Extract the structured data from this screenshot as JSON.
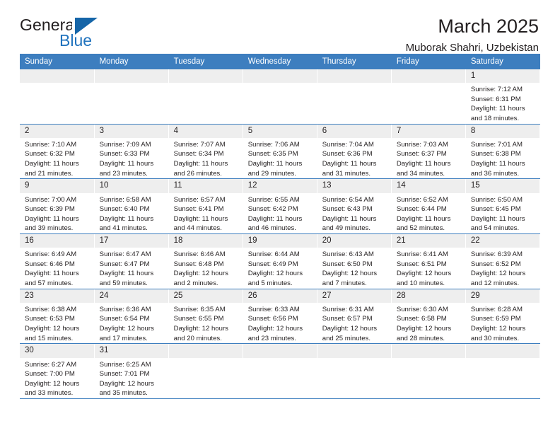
{
  "brand": {
    "name_top": "General",
    "name_bottom": "Blue",
    "accent_color": "#1f72bd",
    "triangle_color": "#1565a8"
  },
  "header": {
    "title": "March 2025",
    "subtitle": "Muborak Shahri, Uzbekistan",
    "header_bg": "#3d7ebf",
    "header_text_color": "#ffffff",
    "daynum_bg": "#eeeeee"
  },
  "weekdays": [
    "Sunday",
    "Monday",
    "Tuesday",
    "Wednesday",
    "Thursday",
    "Friday",
    "Saturday"
  ],
  "weeks": [
    [
      {
        "day": "",
        "lines": []
      },
      {
        "day": "",
        "lines": []
      },
      {
        "day": "",
        "lines": []
      },
      {
        "day": "",
        "lines": []
      },
      {
        "day": "",
        "lines": []
      },
      {
        "day": "",
        "lines": []
      },
      {
        "day": "1",
        "lines": [
          "Sunrise: 7:12 AM",
          "Sunset: 6:31 PM",
          "Daylight: 11 hours",
          "and 18 minutes."
        ]
      }
    ],
    [
      {
        "day": "2",
        "lines": [
          "Sunrise: 7:10 AM",
          "Sunset: 6:32 PM",
          "Daylight: 11 hours",
          "and 21 minutes."
        ]
      },
      {
        "day": "3",
        "lines": [
          "Sunrise: 7:09 AM",
          "Sunset: 6:33 PM",
          "Daylight: 11 hours",
          "and 23 minutes."
        ]
      },
      {
        "day": "4",
        "lines": [
          "Sunrise: 7:07 AM",
          "Sunset: 6:34 PM",
          "Daylight: 11 hours",
          "and 26 minutes."
        ]
      },
      {
        "day": "5",
        "lines": [
          "Sunrise: 7:06 AM",
          "Sunset: 6:35 PM",
          "Daylight: 11 hours",
          "and 29 minutes."
        ]
      },
      {
        "day": "6",
        "lines": [
          "Sunrise: 7:04 AM",
          "Sunset: 6:36 PM",
          "Daylight: 11 hours",
          "and 31 minutes."
        ]
      },
      {
        "day": "7",
        "lines": [
          "Sunrise: 7:03 AM",
          "Sunset: 6:37 PM",
          "Daylight: 11 hours",
          "and 34 minutes."
        ]
      },
      {
        "day": "8",
        "lines": [
          "Sunrise: 7:01 AM",
          "Sunset: 6:38 PM",
          "Daylight: 11 hours",
          "and 36 minutes."
        ]
      }
    ],
    [
      {
        "day": "9",
        "lines": [
          "Sunrise: 7:00 AM",
          "Sunset: 6:39 PM",
          "Daylight: 11 hours",
          "and 39 minutes."
        ]
      },
      {
        "day": "10",
        "lines": [
          "Sunrise: 6:58 AM",
          "Sunset: 6:40 PM",
          "Daylight: 11 hours",
          "and 41 minutes."
        ]
      },
      {
        "day": "11",
        "lines": [
          "Sunrise: 6:57 AM",
          "Sunset: 6:41 PM",
          "Daylight: 11 hours",
          "and 44 minutes."
        ]
      },
      {
        "day": "12",
        "lines": [
          "Sunrise: 6:55 AM",
          "Sunset: 6:42 PM",
          "Daylight: 11 hours",
          "and 46 minutes."
        ]
      },
      {
        "day": "13",
        "lines": [
          "Sunrise: 6:54 AM",
          "Sunset: 6:43 PM",
          "Daylight: 11 hours",
          "and 49 minutes."
        ]
      },
      {
        "day": "14",
        "lines": [
          "Sunrise: 6:52 AM",
          "Sunset: 6:44 PM",
          "Daylight: 11 hours",
          "and 52 minutes."
        ]
      },
      {
        "day": "15",
        "lines": [
          "Sunrise: 6:50 AM",
          "Sunset: 6:45 PM",
          "Daylight: 11 hours",
          "and 54 minutes."
        ]
      }
    ],
    [
      {
        "day": "16",
        "lines": [
          "Sunrise: 6:49 AM",
          "Sunset: 6:46 PM",
          "Daylight: 11 hours",
          "and 57 minutes."
        ]
      },
      {
        "day": "17",
        "lines": [
          "Sunrise: 6:47 AM",
          "Sunset: 6:47 PM",
          "Daylight: 11 hours",
          "and 59 minutes."
        ]
      },
      {
        "day": "18",
        "lines": [
          "Sunrise: 6:46 AM",
          "Sunset: 6:48 PM",
          "Daylight: 12 hours",
          "and 2 minutes."
        ]
      },
      {
        "day": "19",
        "lines": [
          "Sunrise: 6:44 AM",
          "Sunset: 6:49 PM",
          "Daylight: 12 hours",
          "and 5 minutes."
        ]
      },
      {
        "day": "20",
        "lines": [
          "Sunrise: 6:43 AM",
          "Sunset: 6:50 PM",
          "Daylight: 12 hours",
          "and 7 minutes."
        ]
      },
      {
        "day": "21",
        "lines": [
          "Sunrise: 6:41 AM",
          "Sunset: 6:51 PM",
          "Daylight: 12 hours",
          "and 10 minutes."
        ]
      },
      {
        "day": "22",
        "lines": [
          "Sunrise: 6:39 AM",
          "Sunset: 6:52 PM",
          "Daylight: 12 hours",
          "and 12 minutes."
        ]
      }
    ],
    [
      {
        "day": "23",
        "lines": [
          "Sunrise: 6:38 AM",
          "Sunset: 6:53 PM",
          "Daylight: 12 hours",
          "and 15 minutes."
        ]
      },
      {
        "day": "24",
        "lines": [
          "Sunrise: 6:36 AM",
          "Sunset: 6:54 PM",
          "Daylight: 12 hours",
          "and 17 minutes."
        ]
      },
      {
        "day": "25",
        "lines": [
          "Sunrise: 6:35 AM",
          "Sunset: 6:55 PM",
          "Daylight: 12 hours",
          "and 20 minutes."
        ]
      },
      {
        "day": "26",
        "lines": [
          "Sunrise: 6:33 AM",
          "Sunset: 6:56 PM",
          "Daylight: 12 hours",
          "and 23 minutes."
        ]
      },
      {
        "day": "27",
        "lines": [
          "Sunrise: 6:31 AM",
          "Sunset: 6:57 PM",
          "Daylight: 12 hours",
          "and 25 minutes."
        ]
      },
      {
        "day": "28",
        "lines": [
          "Sunrise: 6:30 AM",
          "Sunset: 6:58 PM",
          "Daylight: 12 hours",
          "and 28 minutes."
        ]
      },
      {
        "day": "29",
        "lines": [
          "Sunrise: 6:28 AM",
          "Sunset: 6:59 PM",
          "Daylight: 12 hours",
          "and 30 minutes."
        ]
      }
    ],
    [
      {
        "day": "30",
        "lines": [
          "Sunrise: 6:27 AM",
          "Sunset: 7:00 PM",
          "Daylight: 12 hours",
          "and 33 minutes."
        ]
      },
      {
        "day": "31",
        "lines": [
          "Sunrise: 6:25 AM",
          "Sunset: 7:01 PM",
          "Daylight: 12 hours",
          "and 35 minutes."
        ]
      },
      {
        "day": "",
        "lines": []
      },
      {
        "day": "",
        "lines": []
      },
      {
        "day": "",
        "lines": []
      },
      {
        "day": "",
        "lines": []
      },
      {
        "day": "",
        "lines": []
      }
    ]
  ]
}
